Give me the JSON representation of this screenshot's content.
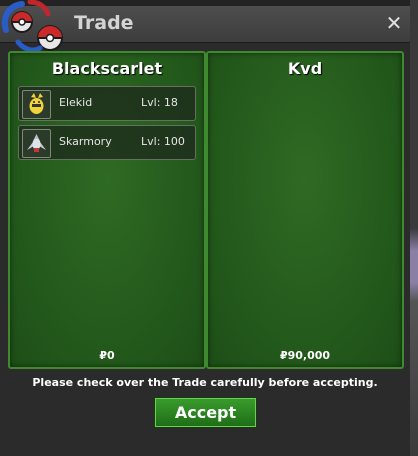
{
  "window": {
    "title": "Trade",
    "close_symbol": "✕"
  },
  "left_panel": {
    "player": "Blackscarlet",
    "items": [
      {
        "name": "Elekid",
        "level": "Lvl: 18",
        "icon": "elekid-icon"
      },
      {
        "name": "Skarmory",
        "level": "Lvl: 100",
        "icon": "skarmory-icon"
      }
    ],
    "money": "₽0"
  },
  "right_panel": {
    "player": "Kvd",
    "items": [],
    "money": "₽90,000"
  },
  "footer": {
    "note": "Please check over the Trade carefully before accepting.",
    "accept_label": "Accept"
  },
  "colors": {
    "panel_green": "#245a1c",
    "panel_border": "#3f8a2e",
    "accept_green": "#2e8a23"
  }
}
